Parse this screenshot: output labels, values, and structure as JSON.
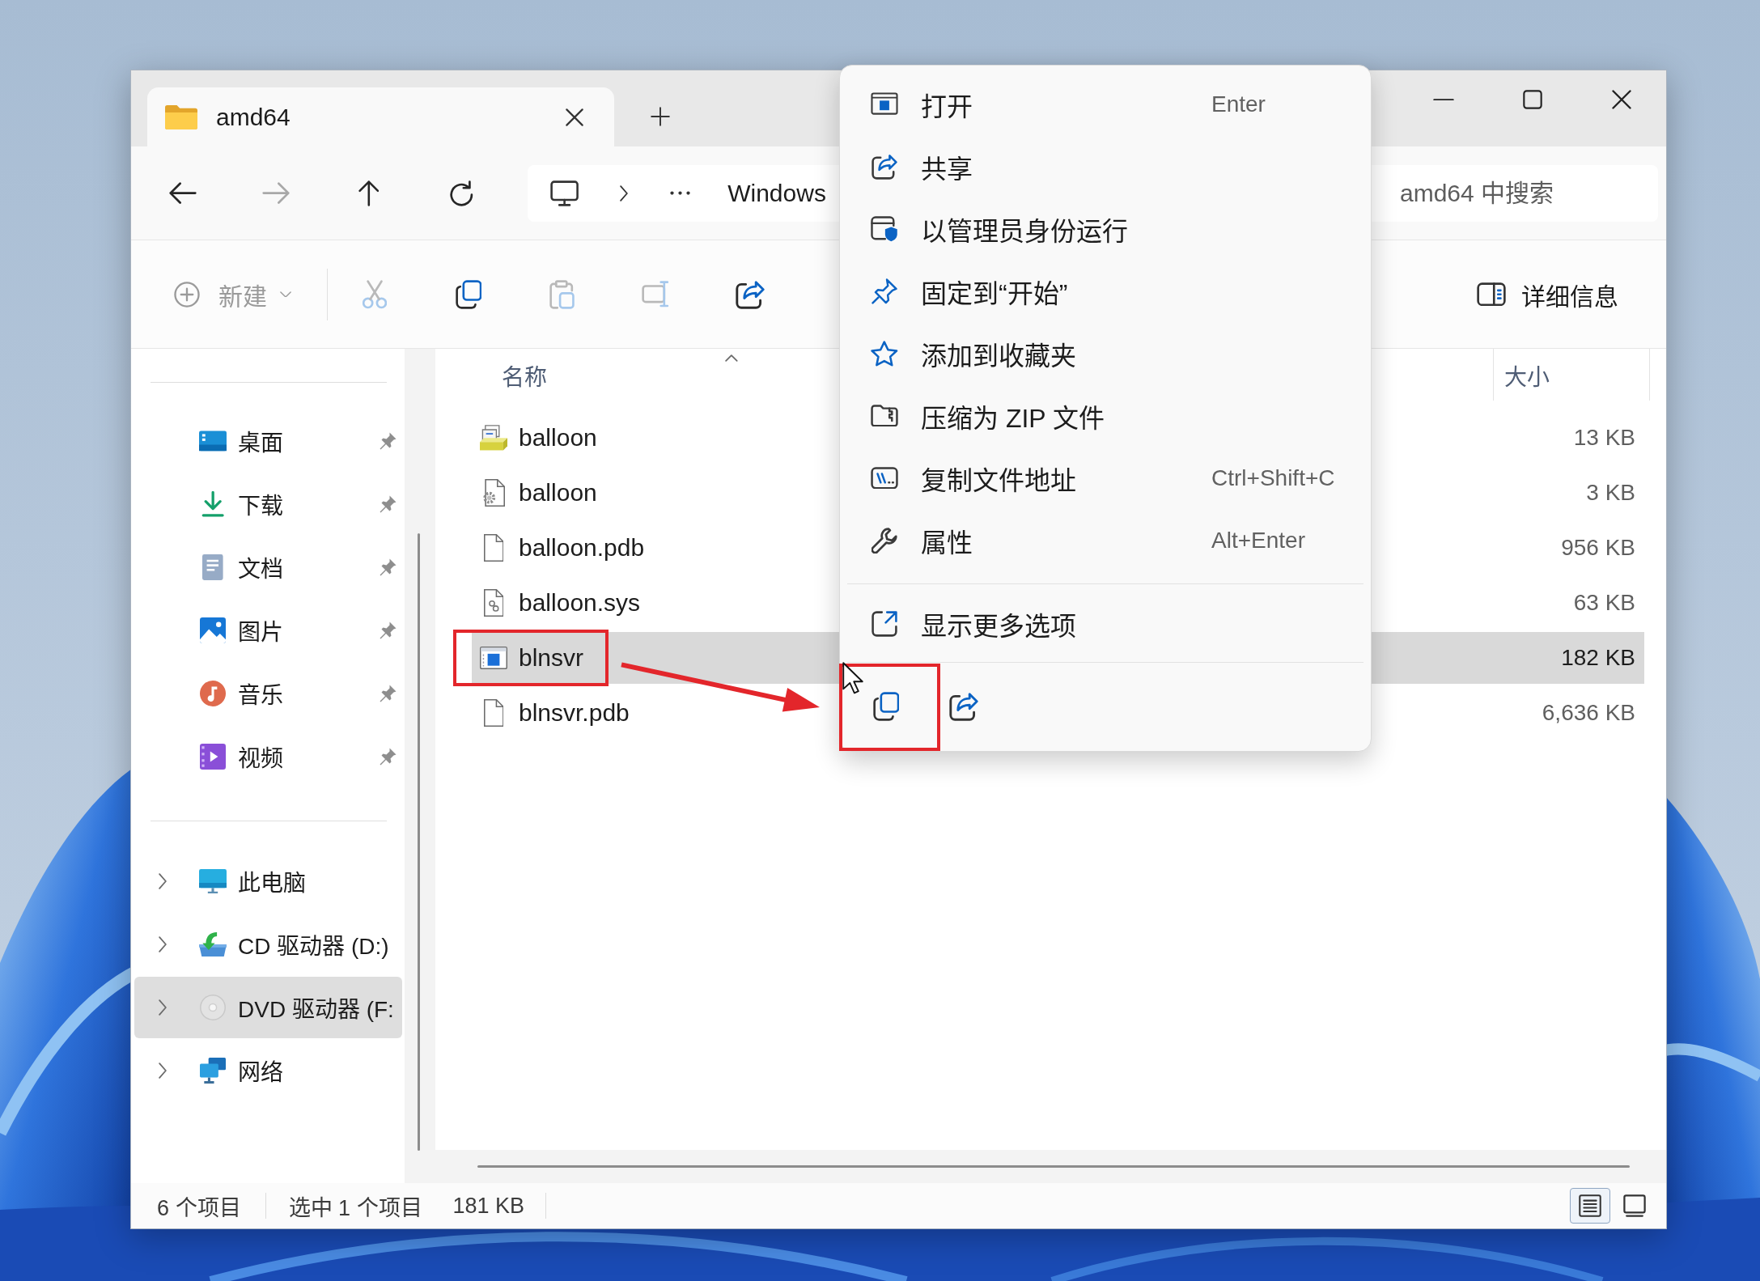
{
  "window": {
    "tabs": [
      {
        "label": "amd64",
        "selected": true
      }
    ]
  },
  "navigation_buttons": [
    {
      "kind": "back",
      "disabled": false
    },
    {
      "kind": "forward",
      "disabled": true
    },
    {
      "kind": "up",
      "disabled": false
    },
    {
      "kind": "refresh",
      "disabled": false
    }
  ],
  "address_bar": {
    "segments": [
      "Windows"
    ]
  },
  "search": {
    "placeholder": "amd64 中搜索"
  },
  "toolbar": {
    "new": {
      "label": "新建",
      "disabled": true
    },
    "actions": [
      {
        "kind": "cut",
        "disabled": true
      },
      {
        "kind": "copy",
        "disabled": false
      },
      {
        "kind": "paste",
        "disabled": true
      },
      {
        "kind": "rename",
        "disabled": true
      },
      {
        "kind": "share",
        "disabled": false
      }
    ],
    "details": {
      "label": "详细信息"
    }
  },
  "sidebar": {
    "quick_access": [
      {
        "label": "桌面",
        "kind": "desktop",
        "pinned": true,
        "selected": false
      },
      {
        "label": "下载",
        "kind": "downloads",
        "pinned": true,
        "selected": false
      },
      {
        "label": "文档",
        "kind": "documents",
        "pinned": true,
        "selected": false
      },
      {
        "label": "图片",
        "kind": "pictures",
        "pinned": true,
        "selected": false
      },
      {
        "label": "音乐",
        "kind": "music",
        "pinned": true,
        "selected": false
      },
      {
        "label": "视频",
        "kind": "videos",
        "pinned": true,
        "selected": false
      }
    ],
    "locations": [
      {
        "label": "此电脑",
        "kind": "pc",
        "expanded": false,
        "selected": false
      },
      {
        "label": "CD 驱动器 (D:)",
        "kind": "cd-drive",
        "expanded": false,
        "selected": false
      },
      {
        "label": "DVD 驱动器 (F:",
        "kind": "dvd-drive",
        "expanded": false,
        "selected": true
      },
      {
        "label": "网络",
        "kind": "network",
        "expanded": false,
        "selected": false
      }
    ]
  },
  "file_list": {
    "columns": [
      {
        "label": "名称",
        "sorted": true
      },
      {
        "label": "大小",
        "sorted": false
      }
    ],
    "files": [
      {
        "name": "balloon",
        "kind": "setup-info",
        "size": "13 KB",
        "selected": false,
        "highlighted": false
      },
      {
        "name": "balloon",
        "kind": "catalog",
        "size": "3 KB",
        "selected": false,
        "highlighted": false
      },
      {
        "name": "balloon.pdb",
        "kind": "blank",
        "size": "956 KB",
        "selected": false,
        "highlighted": false
      },
      {
        "name": "balloon.sys",
        "kind": "system",
        "size": "63 KB",
        "selected": false,
        "highlighted": false
      },
      {
        "name": "blnsvr",
        "kind": "application",
        "size": "182 KB",
        "selected": true,
        "highlighted": true
      },
      {
        "name": "blnsvr.pdb",
        "kind": "blank",
        "size": "6,636 KB",
        "selected": false,
        "highlighted": false
      }
    ]
  },
  "context_menu": {
    "groups": [
      [
        {
          "label": "打开",
          "kind": "open",
          "shortcut": "Enter"
        },
        {
          "label": "共享",
          "kind": "share"
        },
        {
          "label": "以管理员身份运行",
          "kind": "run-as-admin"
        },
        {
          "label": "固定到“开始”",
          "kind": "pin-start"
        },
        {
          "label": "添加到收藏夹",
          "kind": "favorite"
        },
        {
          "label": "压缩为 ZIP 文件",
          "kind": "zip"
        },
        {
          "label": "复制文件地址",
          "kind": "copy-path",
          "shortcut": "Ctrl+Shift+C"
        },
        {
          "label": "属性",
          "kind": "properties",
          "shortcut": "Alt+Enter"
        }
      ],
      [
        {
          "label": "显示更多选项",
          "kind": "more-options"
        }
      ]
    ],
    "quick_actions": [
      {
        "kind": "copy",
        "highlighted": true
      },
      {
        "kind": "share",
        "highlighted": false
      }
    ]
  },
  "status_bar": {
    "item_count": "6 个项目",
    "selection": "选中 1 个项目",
    "selection_size": "181 KB",
    "views": [
      {
        "kind": "details",
        "selected": true
      },
      {
        "kind": "tiles",
        "selected": false
      }
    ]
  }
}
